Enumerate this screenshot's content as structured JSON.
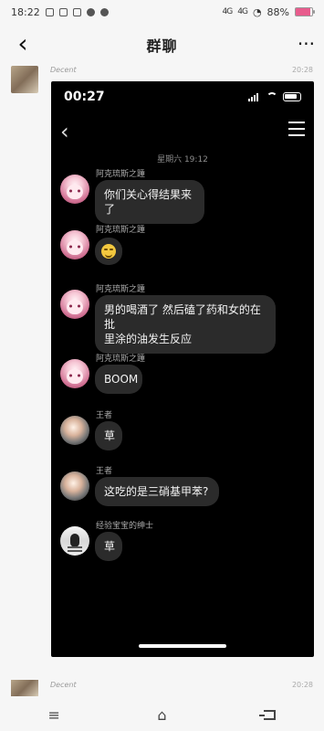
{
  "outer_status": {
    "time": "18:22",
    "signal1": "4G",
    "signal2": "4G",
    "battery": "88%"
  },
  "outer_header": {
    "back": "‹",
    "title": "群聊",
    "more": "···"
  },
  "top_post": {
    "name": "Decent",
    "time": "20:28"
  },
  "screenshot": {
    "status_time": "00:27",
    "date": "星期六 19:12",
    "messages": [
      {
        "name": "阿克琉斯之踵",
        "text": "你们关心得结果来了"
      },
      {
        "name": "阿克琉斯之踵",
        "text": ""
      },
      {
        "name": "阿克琉斯之踵",
        "line1": "男的喝酒了  然后磕了药和女的在批",
        "line2": "里涂的油发生反应"
      },
      {
        "name": "阿克琉斯之踵",
        "text": "BOOM"
      },
      {
        "name": "王者",
        "text": "草"
      },
      {
        "name": "王者",
        "text": "这吃的是三硝基甲苯?"
      },
      {
        "name": "经验宝宝的绅士",
        "text": "草"
      }
    ]
  },
  "bottom_post": {
    "name": "Decent",
    "time": "20:28"
  }
}
